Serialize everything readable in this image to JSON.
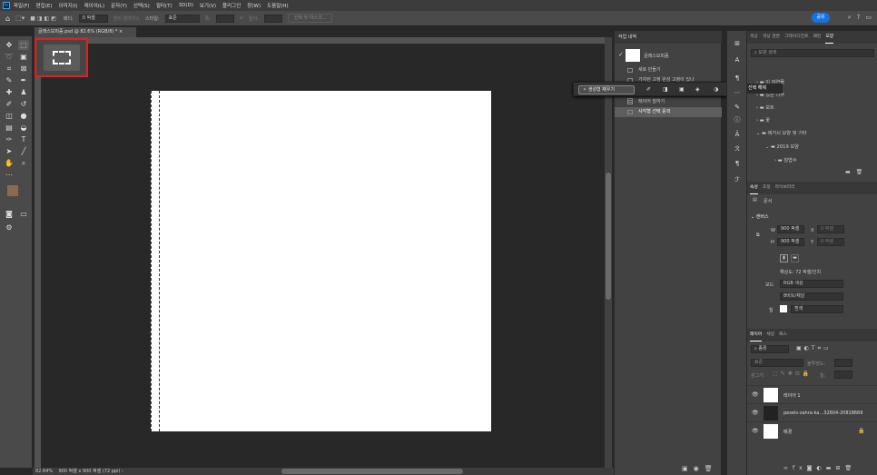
{
  "menu": {
    "items": [
      "파일(F)",
      "편집(E)",
      "이미지(I)",
      "레이어(L)",
      "문자(Y)",
      "선택(S)",
      "필터(T)",
      "3D(D)",
      "보기(V)",
      "플러그인",
      "창(W)",
      "도움말(H)"
    ]
  },
  "options": {
    "feather_label": "페더:",
    "feather_value": "0 픽셀",
    "antialias": "앤티 앨리어스",
    "style_label": "스타일:",
    "style_value": "표준",
    "width_label": "폭:",
    "height_label": "높이:",
    "select_mask": "선택 및 마스크...",
    "share": "공유"
  },
  "document": {
    "tab": "글래스모피즘.psd @ 82.6% (RGB/8) *",
    "zoom": "82.64%",
    "dims": "900 픽셀 x 900 픽셀 (72 ppi)"
  },
  "history": {
    "title": "작업 내역",
    "snapshot": "글래스모피즘",
    "items": [
      "새로 만들기",
      "가지런 고정 완성 고정이 있나",
      "",
      "",
      "레이어 칠하기",
      "사각형 선택 윤곽"
    ]
  },
  "fill_popup": {
    "label": "생성형 채우기"
  },
  "tooltip": "선택 해제",
  "libraries": {
    "tabs": [
      "색상",
      "색상 견본",
      "그레이디언트",
      "패턴",
      "모양"
    ],
    "search_placeholder": "모양 검색",
    "rows": [
      "이 자연물",
      "있는 나무",
      "보트",
      "꽃",
      "레거시 모양 및 기타",
      "2019 모양",
      "침엽수"
    ]
  },
  "properties": {
    "tabs": [
      "속성",
      "조정",
      "라이브러리"
    ],
    "doc_label": "문서",
    "canvas_label": "캔버스",
    "w_label": "W",
    "w_value": "900 픽셀",
    "x_label": "X",
    "x_placeholder": "0 픽셀",
    "h_label": "H",
    "h_value": "900 픽셀",
    "y_label": "Y",
    "y_placeholder": "0 픽셀",
    "resolution": "해상도: 72 픽셀/인치",
    "mode_label": "모드",
    "mode_value": "RGB 색상",
    "depth_value": "8비트/채널",
    "fill_label": "칠",
    "fill_value": "흰색"
  },
  "layers": {
    "tabs": [
      "레이어",
      "채널",
      "패스"
    ],
    "kind": "종류",
    "blend": "표준",
    "opacity_label": "불투명도:",
    "lock_label": "잠그기:",
    "fill_label": "칠:",
    "items": [
      "레이어 1",
      "pexels-zahra-ka...32604-20818669",
      "배경"
    ]
  },
  "colors": {
    "accent": "#1473e6",
    "highlight": "#e02020",
    "foreground": "#8b6a50",
    "background": "#ffffff"
  }
}
